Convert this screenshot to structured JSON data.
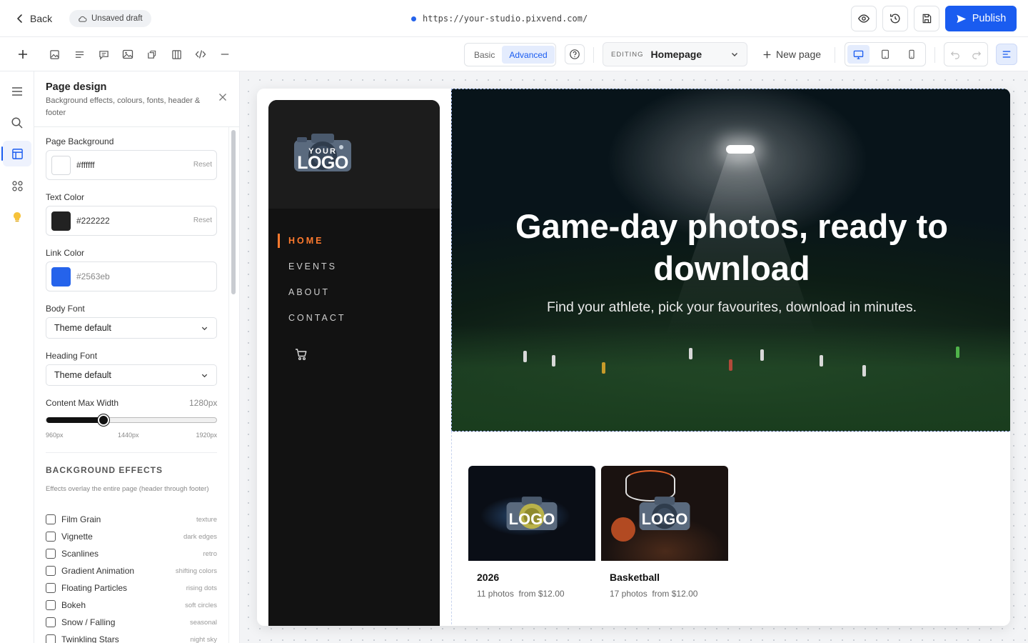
{
  "topbar": {
    "back_label": "Back",
    "draft_badge": "Unsaved draft",
    "site_url": "https://your-studio.pixvend.com/",
    "publish_label": "Publish"
  },
  "toolbar": {
    "mode_basic": "Basic",
    "mode_advanced": "Advanced",
    "editing_label": "EDITING",
    "current_page": "Homepage",
    "new_page_label": "New page",
    "active_device": "desktop"
  },
  "panel": {
    "title": "Page design",
    "subtitle": "Background effects, colours, fonts, header & footer",
    "page_background": {
      "label": "Page Background",
      "value": "#ffffff",
      "swatch": "#ffffff",
      "reset": "Reset"
    },
    "text_color": {
      "label": "Text Color",
      "value": "#222222",
      "swatch": "#222222",
      "reset": "Reset"
    },
    "link_color": {
      "label": "Link Color",
      "placeholder": "#2563eb",
      "swatch": "#2563eb"
    },
    "body_font": {
      "label": "Body Font",
      "value": "Theme default"
    },
    "heading_font": {
      "label": "Heading Font",
      "value": "Theme default"
    },
    "content_max_width": {
      "label": "Content Max Width",
      "value": "1280px",
      "value_num": 1280,
      "min": 960,
      "max": 1920,
      "tick_min": "960px",
      "tick_mid": "1440px",
      "tick_max": "1920px"
    },
    "effects": {
      "heading": "BACKGROUND EFFECTS",
      "description": "Effects overlay the entire page (header through footer)",
      "items": [
        {
          "name": "Film Grain",
          "hint": "texture",
          "checked": false
        },
        {
          "name": "Vignette",
          "hint": "dark edges",
          "checked": false
        },
        {
          "name": "Scanlines",
          "hint": "retro",
          "checked": false
        },
        {
          "name": "Gradient Animation",
          "hint": "shifting colors",
          "checked": false
        },
        {
          "name": "Floating Particles",
          "hint": "rising dots",
          "checked": false
        },
        {
          "name": "Bokeh",
          "hint": "soft circles",
          "checked": false
        },
        {
          "name": "Snow / Falling",
          "hint": "seasonal",
          "checked": false
        },
        {
          "name": "Twinkling Stars",
          "hint": "night sky",
          "checked": false
        }
      ]
    }
  },
  "preview": {
    "logo_top": "YOUR",
    "logo_bottom": "LOGO",
    "nav": [
      {
        "label": "HOME",
        "active": true
      },
      {
        "label": "EVENTS",
        "active": false
      },
      {
        "label": "ABOUT",
        "active": false
      },
      {
        "label": "CONTACT",
        "active": false
      }
    ],
    "hero": {
      "headline": "Game-day photos, ready to download",
      "subheadline": "Find your athlete, pick your favourites, download in minutes."
    },
    "galleries": [
      {
        "title": "2026",
        "photos": "11 photos",
        "price": "from $12.00"
      },
      {
        "title": "Basketball",
        "photos": "17 photos",
        "price": "from $12.00"
      }
    ]
  },
  "colors": {
    "accent": "#1a5cf0",
    "nav_active": "#ff7a2e",
    "sidebar_bg": "#121212"
  }
}
